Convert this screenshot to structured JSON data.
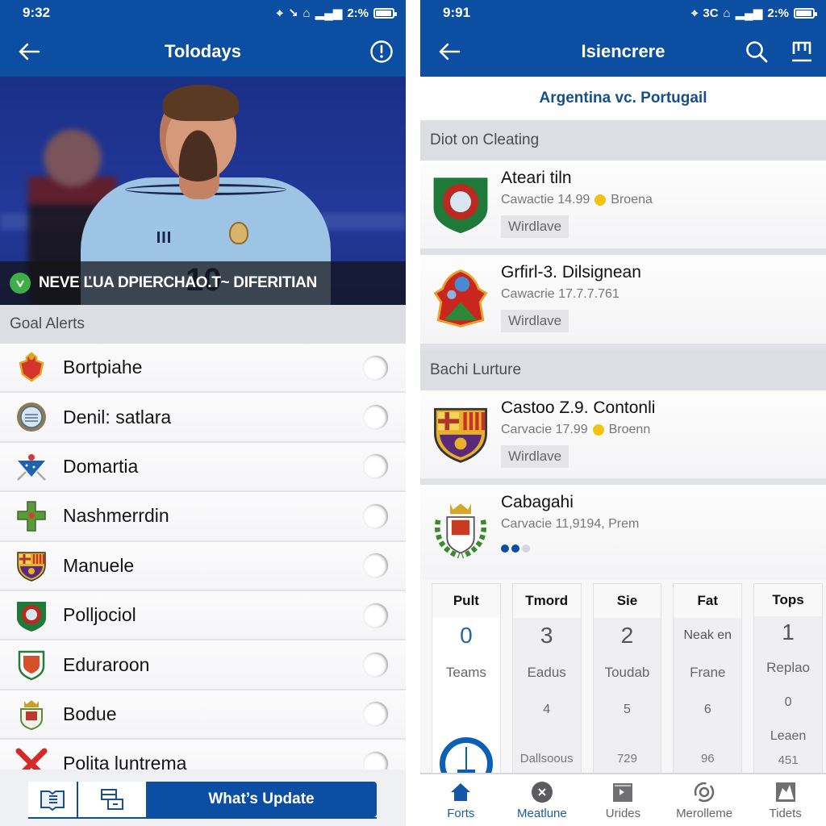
{
  "left_screen": {
    "status_bar": {
      "time": "9:32",
      "network_text": "2:%",
      "battery_percent": 85
    },
    "app_bar": {
      "title": "Tolodays",
      "back_icon": "arrow-left-icon",
      "action_icon": "alert-circle-icon"
    },
    "hero": {
      "caption": "NEVE ĽUA DPIERCHAO.T~ DIFERITIAN",
      "caption_icon": "check-shield-icon"
    },
    "goal_alerts": {
      "header": "Goal Alerts",
      "items": [
        {
          "name": "Bortpiahe",
          "crest": "red-gold-crest-icon",
          "enabled": false
        },
        {
          "name": "Denil: satlara",
          "crest": "round-seal-crest-icon",
          "enabled": false
        },
        {
          "name": "Domartia",
          "crest": "blue-chevron-crest-icon",
          "enabled": false
        },
        {
          "name": "Nashmerrdin",
          "crest": "green-cross-crest-icon",
          "enabled": false
        },
        {
          "name": "Manuele",
          "crest": "striped-shield-crest-icon",
          "enabled": false
        },
        {
          "name": "Polljociol",
          "crest": "green-shield-crest-icon",
          "enabled": false
        },
        {
          "name": "Eduraroon",
          "crest": "white-shield-crest-icon",
          "enabled": false
        },
        {
          "name": "Bodue",
          "crest": "crowned-crest-icon",
          "enabled": false
        },
        {
          "name": "Polita luntrema",
          "crest": "red-x-icon",
          "enabled": false
        }
      ]
    },
    "bottom_actions": {
      "primary_label": "What’s Update",
      "icon_1": "open-book-icon",
      "icon_2": "layout-icon"
    }
  },
  "right_screen": {
    "status_bar": {
      "time": "9:91",
      "network_text": "2:%",
      "extra": "3C",
      "battery_percent": 85
    },
    "app_bar": {
      "title": "Isiencrere",
      "back_icon": "arrow-left-icon",
      "search_icon": "search-icon",
      "action_icon": "tray-icon"
    },
    "match_title": "Argentina vc. Portugail",
    "sections": [
      {
        "header": "Diot on Cleating",
        "cards": [
          {
            "name": "Ateari tiln",
            "meta": "Cawactie 14.99",
            "meta_extra": "Broena",
            "has_dot": true,
            "tag": "Wirdlave",
            "crest": "green-shield-crest-icon"
          },
          {
            "name": "Grfirl-3. Dilsignean",
            "meta": "Cawacrie 17.7.7.761",
            "meta_extra": "",
            "has_dot": false,
            "tag": "Wirdlave",
            "crest": "red-emblem-crest-icon"
          }
        ]
      },
      {
        "header": "Bachi Lurture",
        "cards": [
          {
            "name": "Castoo Z.9. Contonli",
            "meta": "Carvacie 17.99",
            "meta_extra": "Broenn",
            "has_dot": true,
            "tag": "Wirdlave",
            "crest": "striped-shield-crest-icon"
          },
          {
            "name": "Cabagahi",
            "meta": "Carvacie 11,9194, Prem",
            "meta_extra": "",
            "has_dot": false,
            "tag": "",
            "crest": "laurel-crest-icon",
            "pager": {
              "total": 3,
              "active": 2
            }
          }
        ]
      }
    ],
    "stats": [
      {
        "header": "Pult",
        "value": "0",
        "label": "Teams",
        "row3": "",
        "row4": "",
        "footer": "",
        "gauge": true
      },
      {
        "header": "Tmord",
        "value": "3",
        "label": "Eadus",
        "row3": "4",
        "row4": "",
        "footer": "Dallsoous"
      },
      {
        "header": "Sie",
        "value": "2",
        "label": "Toudab",
        "row3": "5",
        "row4": "",
        "footer": "729"
      },
      {
        "header": "Fat",
        "value": "Neak en",
        "label": "Frane",
        "row3": "6",
        "row4": "",
        "footer": "96"
      },
      {
        "header": "Tops",
        "value": "1",
        "label": "Replao",
        "row3": "0",
        "row4": "Leaen",
        "footer": "451"
      }
    ],
    "tab_bar": [
      {
        "label": "Forts",
        "icon": "home-icon",
        "active": true
      },
      {
        "label": "Meatlune",
        "icon": "close-circle-icon",
        "active": true
      },
      {
        "label": "Urides",
        "icon": "calendar-icon",
        "active": false
      },
      {
        "label": "Merolleme",
        "icon": "target-icon",
        "active": false
      },
      {
        "label": "Tidets",
        "icon": "image-icon",
        "active": false
      }
    ]
  }
}
